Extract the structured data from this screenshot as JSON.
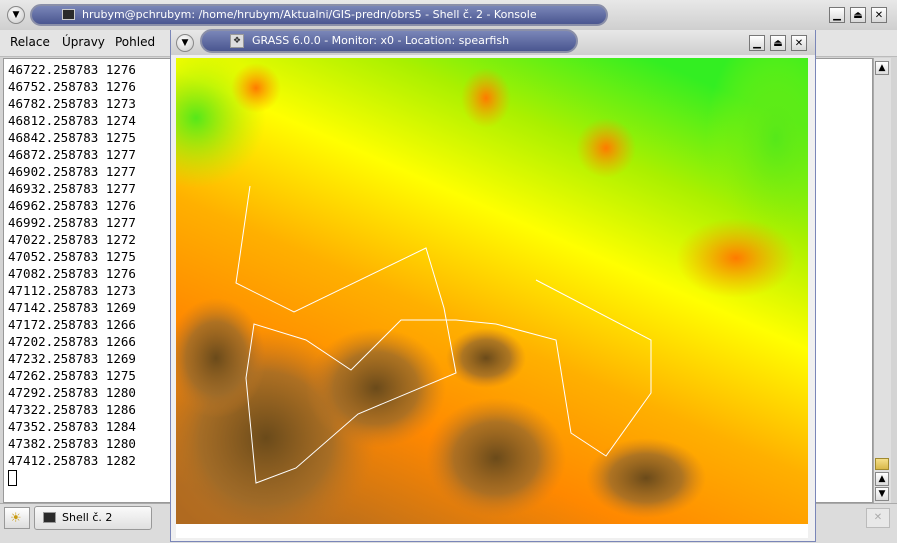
{
  "konsole": {
    "title": "hrubym@pchrubym: /home/hrubym/Aktualni/GIS-predn/obrs5 - Shell č. 2 - Konsole",
    "menu": [
      "Relace",
      "Úpravy",
      "Pohled"
    ],
    "lines": [
      "46722.258783 1276",
      "46752.258783 1276",
      "46782.258783 1273",
      "46812.258783 1274",
      "46842.258783 1275",
      "46872.258783 1277",
      "46902.258783 1277",
      "46932.258783 1277",
      "46962.258783 1276",
      "46992.258783 1277",
      "47022.258783 1272",
      "47052.258783 1275",
      "47082.258783 1276",
      "47112.258783 1273",
      "47142.258783 1269",
      "47172.258783 1266",
      "47202.258783 1266",
      "47232.258783 1269",
      "47262.258783 1275",
      "47292.258783 1280",
      "47322.258783 1286",
      "47352.258783 1284",
      "47382.258783 1280",
      "47412.258783 1282"
    ],
    "tab_label": "Shell č. 2"
  },
  "grass": {
    "title": "GRASS 6.0.0 - Monitor: x0 - Location: spearfish"
  },
  "icons": {
    "menu": "chevron-down-icon",
    "minimize": "minimize-icon",
    "maximize": "maximize-icon",
    "close": "close-icon",
    "new_session": "new-session-icon",
    "terminal": "terminal-icon",
    "scroll_up": "arrow-up-icon",
    "scroll_down": "arrow-down-icon"
  }
}
